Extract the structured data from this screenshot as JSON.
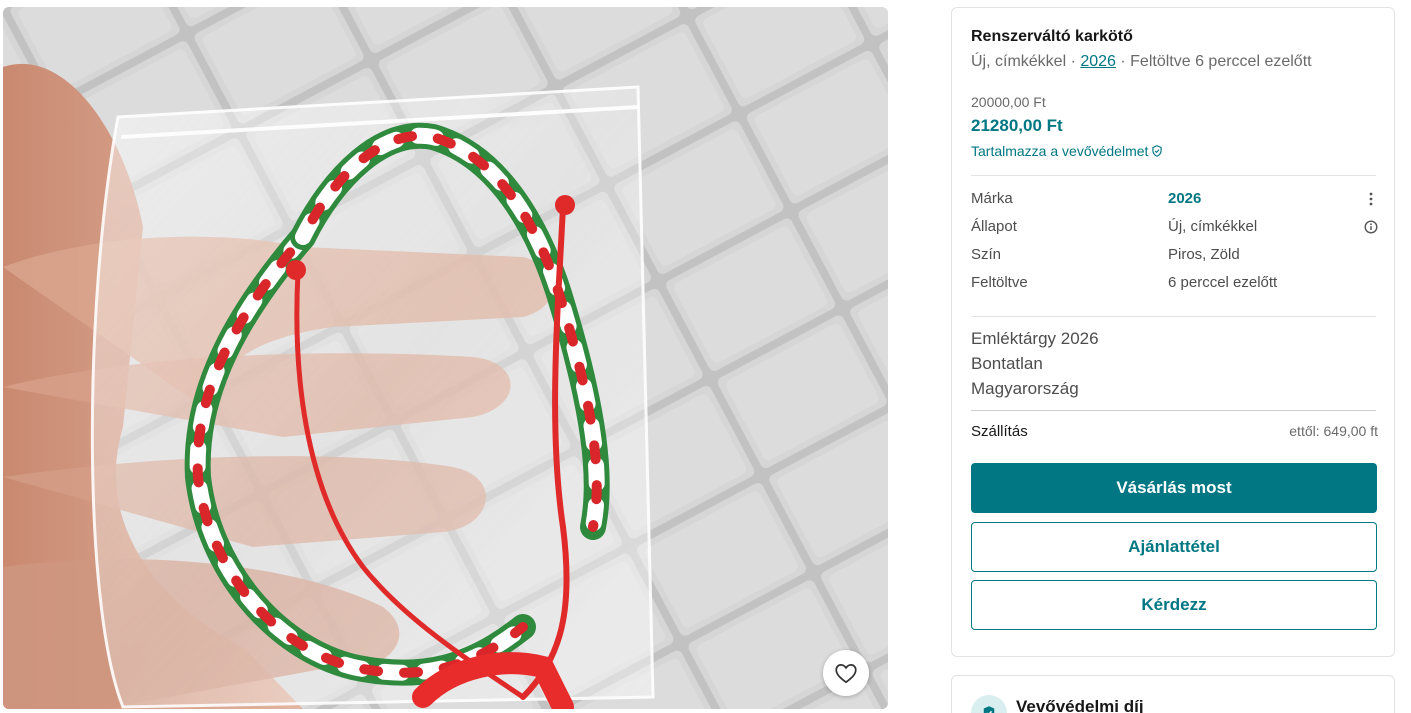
{
  "listing": {
    "title": "Renszerváltó karkötő",
    "condition_short": "Új, címkékkel",
    "separator1": " · ",
    "brand_link": "2026",
    "separator2": " · ",
    "uploaded_short": "Feltöltve 6 perccel ezelőtt",
    "price_original": "20000,00 Ft",
    "price_total": "21280,00 Ft",
    "buyer_protection": "Tartalmazza a vevővédelmet"
  },
  "details": [
    {
      "label": "Márka",
      "value": "2026",
      "icon": "more-vertical-icon"
    },
    {
      "label": "Állapot",
      "value": "Új, címkékkel",
      "icon": "info-icon"
    },
    {
      "label": "Szín",
      "value": "Piros, Zöld"
    },
    {
      "label": "Feltöltve",
      "value": "6 perccel ezelőtt"
    }
  ],
  "description": [
    "Emléktárgy 2026",
    "Bontatlan",
    "Magyarország"
  ],
  "shipping": {
    "label": "Szállítás",
    "value": "ettől: 649,00 ft"
  },
  "buttons": {
    "buy": "Vásárlás most",
    "offer": "Ajánlattétel",
    "ask": "Kérdezz"
  },
  "protection_card": {
    "title": "Vevővédelmi díj"
  },
  "colors": {
    "accent": "#007782",
    "text": "#171717",
    "muted": "#6a6a6a",
    "border": "#e3e3e3"
  }
}
